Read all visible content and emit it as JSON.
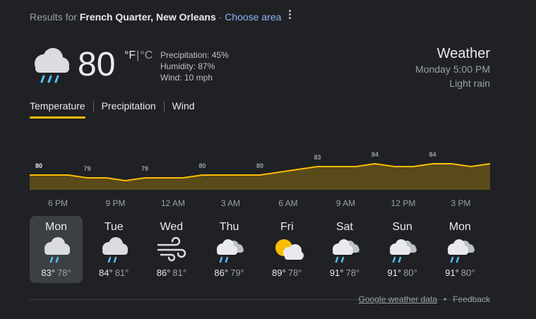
{
  "header": {
    "results_prefix": "Results for",
    "location": "French Quarter, New Orleans",
    "separator": "·",
    "choose_area": "Choose area"
  },
  "current": {
    "icon": "rain-cloud-icon",
    "temperature": "80",
    "unit_f": "°F",
    "unit_sep": "|",
    "unit_c": "°C",
    "precipitation": "Precipitation: 45%",
    "humidity": "Humidity: 87%",
    "wind": "Wind: 10 mph"
  },
  "summary": {
    "title": "Weather",
    "datetime": "Monday 5:00 PM",
    "condition": "Light rain"
  },
  "tabs": [
    {
      "label": "Temperature",
      "active": true
    },
    {
      "label": "Precipitation",
      "active": false
    },
    {
      "label": "Wind",
      "active": false
    }
  ],
  "chart_data": {
    "type": "area",
    "color": "#fbbc04",
    "fill": "#594a1a",
    "labels": [
      {
        "i": 0,
        "v": 80,
        "bold": true
      },
      {
        "i": 3,
        "v": 79
      },
      {
        "i": 6,
        "v": 79
      },
      {
        "i": 9,
        "v": 80
      },
      {
        "i": 12,
        "v": 80
      },
      {
        "i": 15,
        "v": 83
      },
      {
        "i": 18,
        "v": 84
      },
      {
        "i": 21,
        "v": 84
      }
    ],
    "x_ticks": [
      "6 PM",
      "9 PM",
      "12 AM",
      "3 AM",
      "6 AM",
      "9 AM",
      "12 PM",
      "3 PM"
    ],
    "values": [
      80,
      80,
      80,
      79,
      79,
      78,
      79,
      79,
      79,
      80,
      80,
      80,
      80,
      81,
      82,
      83,
      83,
      83,
      84,
      83,
      83,
      84,
      84,
      83,
      84
    ]
  },
  "forecast": [
    {
      "day": "Mon",
      "hi": "83°",
      "lo": "78°",
      "icon": "rain-cloud-icon",
      "selected": true
    },
    {
      "day": "Tue",
      "hi": "84°",
      "lo": "81°",
      "icon": "rain-cloud-icon",
      "selected": false
    },
    {
      "day": "Wed",
      "hi": "86°",
      "lo": "81°",
      "icon": "wind-icon",
      "selected": false
    },
    {
      "day": "Thu",
      "hi": "86°",
      "lo": "79°",
      "icon": "rain-clouds-icon",
      "selected": false
    },
    {
      "day": "Fri",
      "hi": "89°",
      "lo": "78°",
      "icon": "partly-cloudy-icon",
      "selected": false
    },
    {
      "day": "Sat",
      "hi": "91°",
      "lo": "78°",
      "icon": "rain-clouds-icon",
      "selected": false
    },
    {
      "day": "Sun",
      "hi": "91°",
      "lo": "80°",
      "icon": "rain-clouds-icon",
      "selected": false
    },
    {
      "day": "Mon",
      "hi": "91°",
      "lo": "80°",
      "icon": "rain-clouds-icon",
      "selected": false
    }
  ],
  "footer": {
    "data_link": "Google weather data",
    "dot": "•",
    "feedback": "Feedback"
  }
}
